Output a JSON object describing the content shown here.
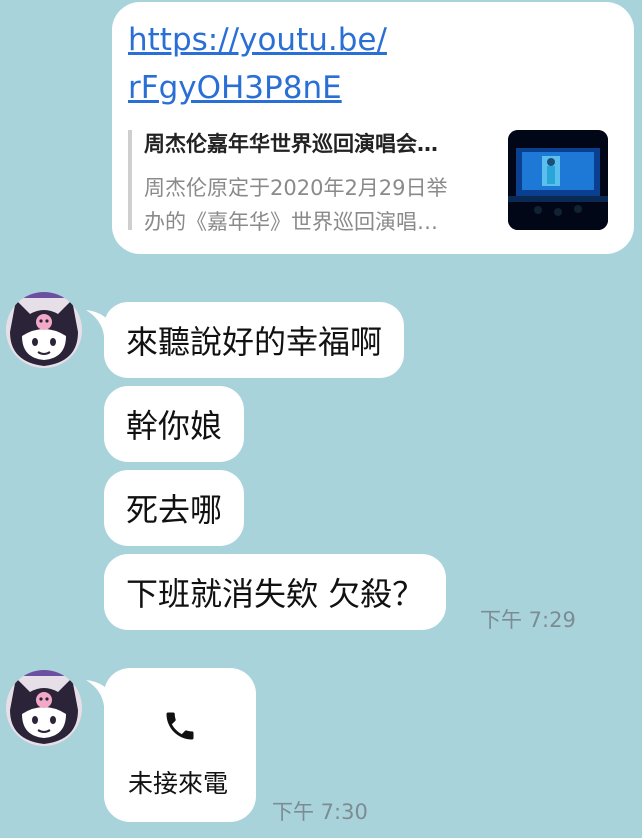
{
  "link_card": {
    "url_line1": "https://youtu.be/",
    "url_line2": "rFgyOH3P8nE",
    "title": "周杰伦嘉年华世界巡回演唱会…",
    "desc_line1": "周杰伦原定于2020年2月29日举",
    "desc_line2": "办的《嘉年华》世界巡回演唱…"
  },
  "messages": [
    {
      "text": "來聽說好的幸福啊"
    },
    {
      "text": "幹你娘"
    },
    {
      "text": "死去哪"
    },
    {
      "text": "下班就消失欸 欠殺？"
    }
  ],
  "times": {
    "group1": "下午 7:29",
    "group2": "下午 7:30"
  },
  "call": {
    "label": "未接來電",
    "icon": "phone-icon"
  },
  "colors": {
    "background": "#a9d3db",
    "bubble": "#ffffff",
    "link": "#2a6fd6"
  }
}
